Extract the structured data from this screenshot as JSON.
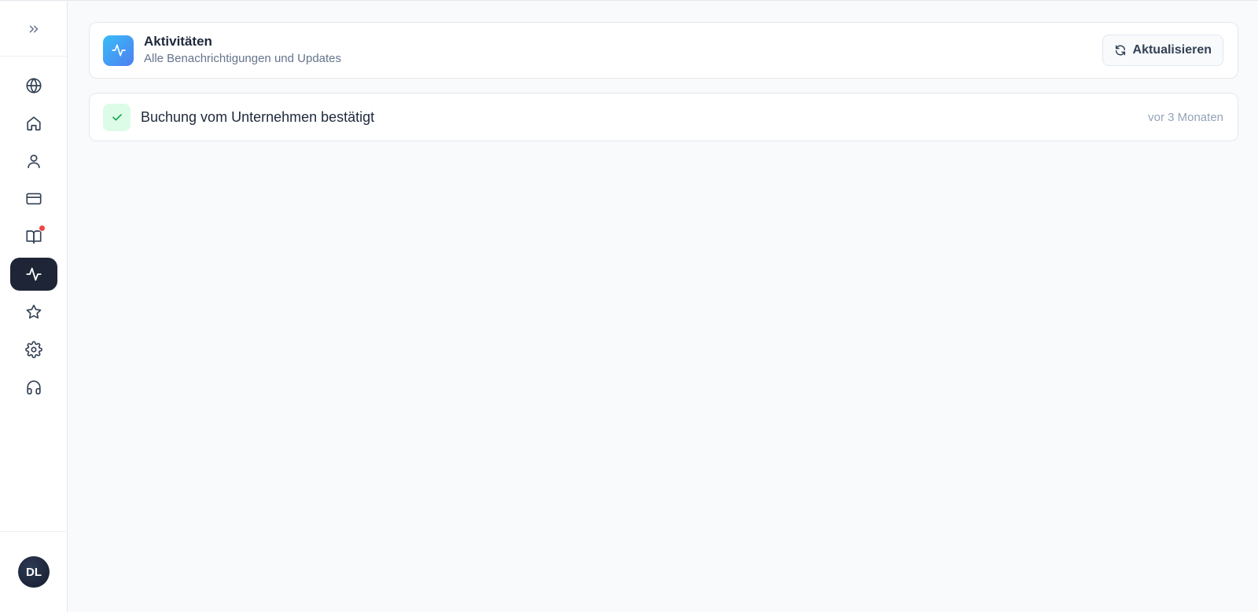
{
  "sidebar": {
    "expand_icon": "chevrons-right-icon",
    "items": [
      {
        "name": "globe",
        "icon": "globe-icon",
        "active": false
      },
      {
        "name": "home",
        "icon": "home-icon",
        "active": false
      },
      {
        "name": "profile",
        "icon": "user-icon",
        "active": false
      },
      {
        "name": "payments",
        "icon": "credit-card-icon",
        "active": false
      },
      {
        "name": "bookings",
        "icon": "book-open-icon",
        "active": false,
        "has_notification": true
      },
      {
        "name": "activity",
        "icon": "activity-icon",
        "active": true
      },
      {
        "name": "favorites",
        "icon": "star-icon",
        "active": false
      },
      {
        "name": "settings",
        "icon": "gear-icon",
        "active": false
      },
      {
        "name": "support",
        "icon": "headphones-icon",
        "active": false
      }
    ],
    "avatar_initials": "DL"
  },
  "header": {
    "title": "Aktivitäten",
    "subtitle": "Alle Benachrichtigungen und Updates",
    "refresh_label": "Aktualisieren"
  },
  "activities": [
    {
      "text": "Buchung vom Unternehmen bestätigt",
      "time": "vor 3 Monaten",
      "icon": "check-icon"
    }
  ],
  "colors": {
    "accent_gradient_start": "#38bdf8",
    "accent_gradient_end": "#4f7ff0",
    "active_nav": "#1e2536",
    "notification": "#ef4444",
    "success_bg": "#dcfce7",
    "success": "#16a34a"
  }
}
